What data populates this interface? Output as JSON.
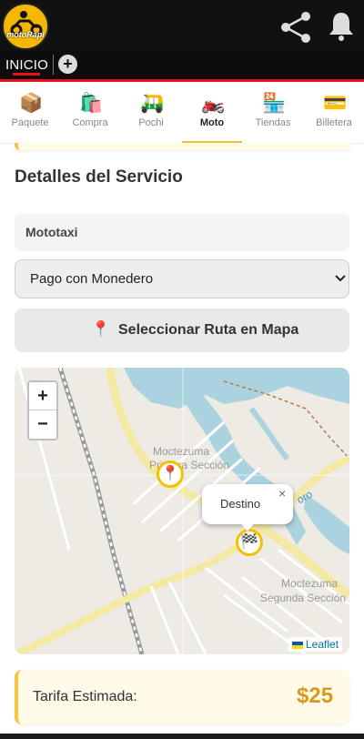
{
  "app": {
    "brand": "motoRapi",
    "accent_color": "#f1c232",
    "header_color": "#111111",
    "tab_active_color": "#e3121b"
  },
  "header": {
    "icons": [
      "share-icon",
      "bell-icon"
    ]
  },
  "tabs": {
    "active": "INICIO",
    "add_label": "+"
  },
  "categories": [
    {
      "label": "Paquete",
      "icon": "package-icon",
      "glyph": "📦"
    },
    {
      "label": "Compra",
      "icon": "shopping-bag-icon",
      "glyph": "🛍️"
    },
    {
      "label": "Pochi",
      "icon": "rickshaw-icon",
      "glyph": "🛺"
    },
    {
      "label": "Moto",
      "icon": "motorcycle-icon",
      "glyph": "🏍️"
    },
    {
      "label": "Tiendas",
      "icon": "store-icon",
      "glyph": "🏪"
    },
    {
      "label": "Billetera",
      "icon": "wallet-icon",
      "glyph": "💳"
    }
  ],
  "active_category": "Moto",
  "service": {
    "title": "Detalles del Servicio",
    "service_type": "Mototaxi",
    "payment_selected": "Pago con Monedero",
    "route_button": "Seleccionar Ruta en Mapa",
    "route_button_icon": "📍"
  },
  "map": {
    "zoom_in": "+",
    "zoom_out": "−",
    "popup_label": "Destino",
    "popup_close": "×",
    "origin_marker": "📍",
    "destination_marker": "🏁",
    "attribution": "Leaflet",
    "place_1_line1": "Moctezuma",
    "place_1_line2": "Primera Sección",
    "place_2_line1": "Moctezuma",
    "place_2_line2": "Segunda Sección",
    "road_label": "oro"
  },
  "fare": {
    "label": "Tarifa Estimada:",
    "value": "$25"
  }
}
